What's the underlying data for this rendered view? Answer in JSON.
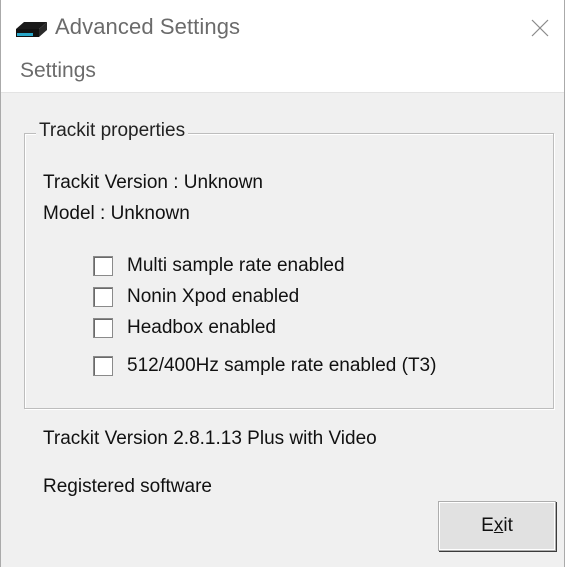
{
  "window": {
    "title": "Advanced Settings",
    "app_icon": "trackit-device-icon",
    "close_icon": "close-icon"
  },
  "menu": {
    "items": [
      {
        "label": "Settings"
      }
    ]
  },
  "group": {
    "legend": "Trackit properties",
    "version_line": "Trackit Version : Unknown",
    "model_line": "Model : Unknown",
    "checkboxes": [
      {
        "label": "Multi sample rate enabled",
        "checked": false
      },
      {
        "label": "Nonin Xpod enabled",
        "checked": false
      },
      {
        "label": "Headbox enabled",
        "checked": false
      },
      {
        "label": "512/400Hz sample rate enabled (T3)",
        "checked": false
      }
    ]
  },
  "footer": {
    "version_text": "Trackit Version 2.8.1.13 Plus with Video",
    "registration_text": "Registered software"
  },
  "buttons": {
    "exit": {
      "label_pre": "E",
      "label_mnemonic": "x",
      "label_post": "it"
    }
  },
  "colors": {
    "dialog_bg": "#f0f0f0",
    "title_text": "#6b6b6b",
    "border": "#bdbdbd"
  }
}
